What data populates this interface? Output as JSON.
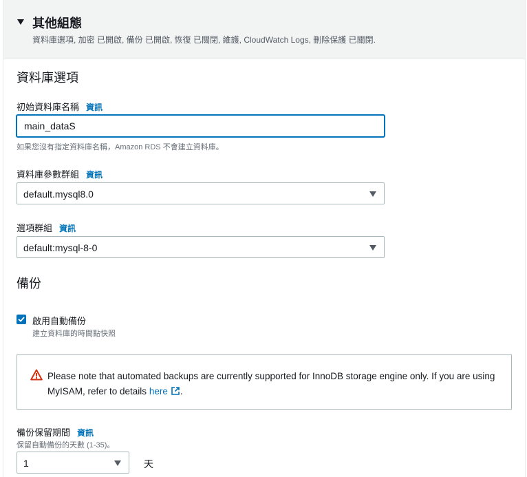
{
  "header": {
    "title": "其他組態",
    "description": "資料庫選項, 加密 已開啟, 備份 已開啟, 恢復 已關閉, 維護, CloudWatch Logs, 刪除保護 已關閉."
  },
  "db_options": {
    "title": "資料庫選項",
    "initial_db": {
      "label": "初始資料庫名稱",
      "info": "資訊",
      "value": "main_dataS",
      "hint": "如果您沒有指定資料庫名稱，Amazon RDS 不會建立資料庫。"
    },
    "param_group": {
      "label": "資料庫參數群組",
      "info": "資訊",
      "value": "default.mysql8.0"
    },
    "option_group": {
      "label": "選項群組",
      "info": "資訊",
      "value": "default:mysql-8-0"
    }
  },
  "backup": {
    "title": "備份",
    "enable_auto_backup": {
      "label": "啟用自動備份",
      "hint": "建立資料庫的時間點快照",
      "checked": true
    },
    "alert": {
      "text": "Please note that automated backups are currently supported for InnoDB storage engine only. If you are using MyISAM, refer to details",
      "link": "here",
      "suffix": ".",
      "icon": "warning-icon"
    },
    "retention": {
      "label": "備份保留期間",
      "info": "資訊",
      "hint": "保留自動備份的天數 (1-35)。",
      "value": "1",
      "unit": "天"
    }
  },
  "colors": {
    "accent": "#0073bb",
    "warning": "#d13212",
    "header_bg": "#f2f3f3"
  }
}
